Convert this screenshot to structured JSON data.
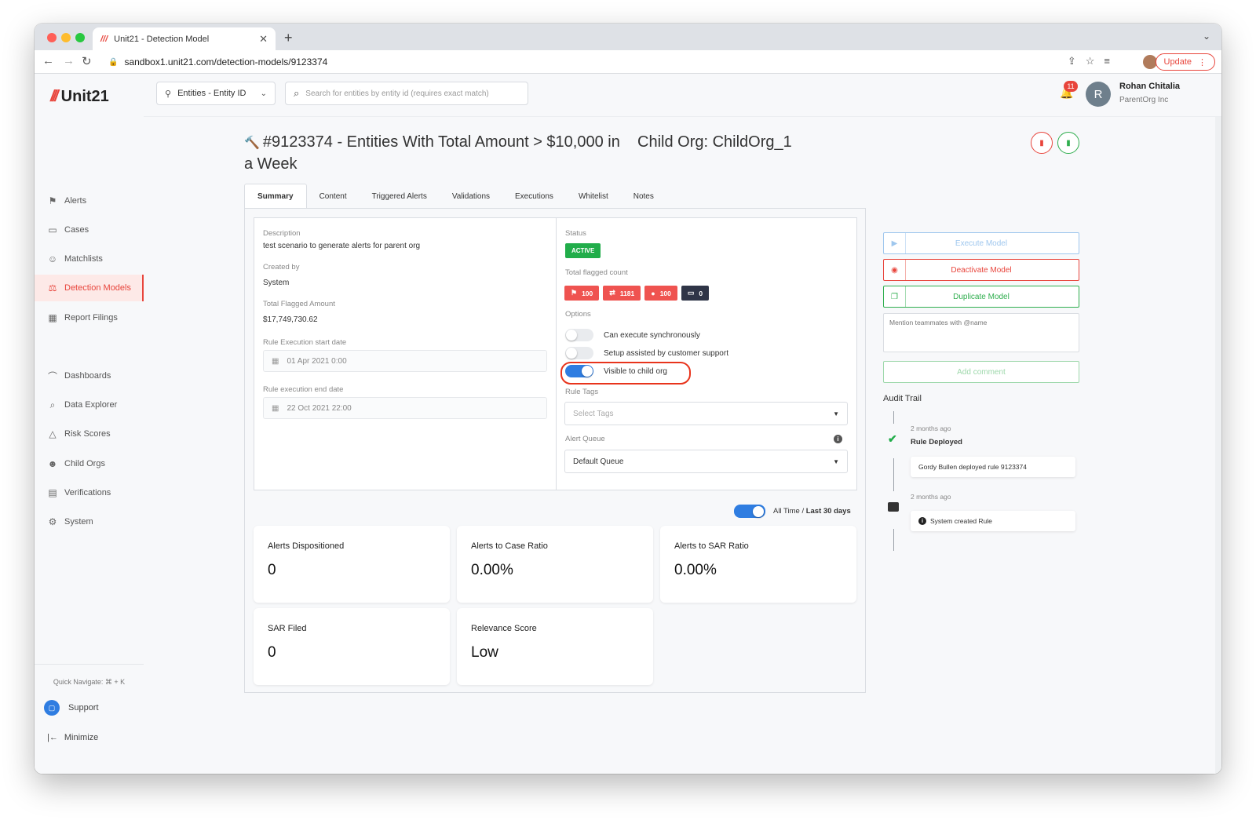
{
  "browser": {
    "tab_title": "Unit21 - Detection Model",
    "tab_favicon": "///",
    "url": "sandbox1.unit21.com/detection-models/9123374",
    "update_label": "Update"
  },
  "sidebar": {
    "logo_mark": "///",
    "logo_text": "Unit21",
    "items": [
      {
        "label": "Alerts",
        "icon": "flag-icon"
      },
      {
        "label": "Cases",
        "icon": "briefcase-icon"
      },
      {
        "label": "Matchlists",
        "icon": "user-check-icon"
      },
      {
        "label": "Detection Models",
        "icon": "scale-icon"
      },
      {
        "label": "Report Filings",
        "icon": "building-icon"
      },
      {
        "label": "Dashboards",
        "icon": "chart-icon"
      },
      {
        "label": "Data Explorer",
        "icon": "table-search-icon"
      },
      {
        "label": "Risk Scores",
        "icon": "warning-icon"
      },
      {
        "label": "Child Orgs",
        "icon": "users-icon"
      },
      {
        "label": "Verifications",
        "icon": "id-card-icon"
      },
      {
        "label": "System",
        "icon": "gear-icon"
      }
    ],
    "quick_navigate": "Quick Navigate: ⌘ + K",
    "support": "Support",
    "minimize": "Minimize"
  },
  "header": {
    "entity_select": "Entities - Entity ID",
    "search_placeholder": "Search for entities by entity id (requires exact match)",
    "notification_count": "11",
    "user_initial": "R",
    "user_name": "Rohan Chitalia",
    "user_org": "ParentOrg Inc"
  },
  "page": {
    "title": "#9123374 - Entities With Total Amount > $10,000 in a Week",
    "child_org": "Child Org: ChildOrg_1"
  },
  "tabs": [
    "Summary",
    "Content",
    "Triggered Alerts",
    "Validations",
    "Executions",
    "Whitelist",
    "Notes"
  ],
  "summary": {
    "description_label": "Description",
    "description": "test scenario to generate alerts for parent org",
    "created_by_label": "Created by",
    "created_by": "System",
    "total_flagged_amount_label": "Total Flagged Amount",
    "total_flagged_amount": "$17,749,730.62",
    "start_date_label": "Rule Execution start date",
    "start_date": "01 Apr 2021 0:00",
    "end_date_label": "Rule execution end date",
    "end_date": "22 Oct 2021 22:00",
    "status_label": "Status",
    "status": "ACTIVE",
    "flagged_count_label": "Total flagged count",
    "flagged_counts": [
      {
        "icon": "flag-icon",
        "value": "100"
      },
      {
        "icon": "transfer-icon",
        "value": "1181"
      },
      {
        "icon": "user-icon",
        "value": "100"
      },
      {
        "icon": "card-icon",
        "value": "0"
      }
    ],
    "options_label": "Options",
    "options": [
      {
        "label": "Can execute synchronously",
        "on": false
      },
      {
        "label": "Setup assisted by customer support",
        "on": false
      },
      {
        "label": "Visible to child org",
        "on": true
      }
    ],
    "rule_tags_label": "Rule Tags",
    "rule_tags_placeholder": "Select Tags",
    "alert_queue_label": "Alert Queue",
    "alert_queue": "Default Queue"
  },
  "range": {
    "all_time": "All Time",
    "separator": "/",
    "last_30": "Last 30 days"
  },
  "stats": [
    {
      "title": "Alerts Dispositioned",
      "value": "0"
    },
    {
      "title": "Alerts to Case Ratio",
      "value": "0.00%"
    },
    {
      "title": "Alerts to SAR Ratio",
      "value": "0.00%"
    },
    {
      "title": "SAR Filed",
      "value": "0"
    },
    {
      "title": "Relevance Score",
      "value": "Low"
    }
  ],
  "actions": {
    "execute": "Execute Model",
    "deactivate": "Deactivate Model",
    "duplicate": "Duplicate Model",
    "comment_placeholder": "Mention teammates with @name",
    "add_comment": "Add comment"
  },
  "audit": {
    "title": "Audit Trail",
    "events": [
      {
        "time": "2 months ago",
        "event": "Rule Deployed",
        "detail": "Gordy Bullen deployed rule 9123374"
      },
      {
        "time": "2 months ago",
        "detail": "System created Rule"
      }
    ]
  },
  "colors": {
    "brand_red": "#e8453c",
    "active_green": "#21ad4a",
    "toggle_blue": "#2f7de1",
    "highlight_ring": "#e8341c"
  }
}
